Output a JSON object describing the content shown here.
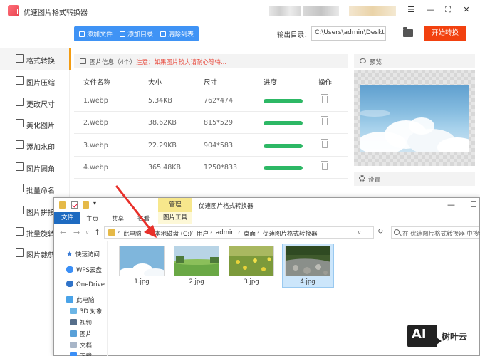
{
  "app": {
    "title": "优速图片格式转换器"
  },
  "sidebar": {
    "items": [
      {
        "label": "格式转换"
      },
      {
        "label": "图片压缩"
      },
      {
        "label": "更改尺寸"
      },
      {
        "label": "美化图片"
      },
      {
        "label": "添加水印"
      },
      {
        "label": "图片圆角"
      },
      {
        "label": "批量命名"
      },
      {
        "label": "图片拼接"
      },
      {
        "label": "批量旋转"
      },
      {
        "label": "图片裁剪"
      }
    ]
  },
  "toolbar": {
    "add_file": "添加文件",
    "add_folder": "添加目录",
    "clear_list": "清除列表",
    "output_label": "输出目录：",
    "output_path": "C:\\Users\\admin\\Deskto",
    "convert_label": "开始转换"
  },
  "file_panel": {
    "title": "图片信息",
    "count": "（4个）",
    "note": "注意：如果图片较大请耐心等待...",
    "columns": [
      "文件名称",
      "大小",
      "尺寸",
      "进度",
      "操作"
    ],
    "rows": [
      {
        "name": "1.webp",
        "size": "5.34KB",
        "dims": "762*474",
        "progress": 1.0
      },
      {
        "name": "2.webp",
        "size": "38.62KB",
        "dims": "815*529",
        "progress": 1.0
      },
      {
        "name": "3.webp",
        "size": "22.29KB",
        "dims": "904*583",
        "progress": 1.0
      },
      {
        "name": "4.webp",
        "size": "365.48KB",
        "dims": "1250*833",
        "progress": 1.0
      }
    ]
  },
  "preview": {
    "title": "预览",
    "settings_title": "设置"
  },
  "explorer": {
    "context_tab": "管理",
    "title": "优速图片格式转换器",
    "ribbon": {
      "file": "文件",
      "home": "主页",
      "share": "共享",
      "view": "查看",
      "tools": "图片工具"
    },
    "breadcrumb": [
      "此电脑",
      "本地磁盘 (C:)",
      "用户",
      "admin",
      "桌面",
      "优速图片格式转换器"
    ],
    "search_placeholder": "在 优速图片格式转换器 中搜索",
    "nav": {
      "quick_access": "快速访问",
      "wps": "WPS云盘",
      "onedrive": "OneDrive",
      "this_pc": "此电脑",
      "objects3d": "3D 对象",
      "videos": "视频",
      "pictures": "图片",
      "documents": "文档",
      "downloads": "下载"
    },
    "files": [
      {
        "name": "1.jpg"
      },
      {
        "name": "2.jpg"
      },
      {
        "name": "3.jpg"
      },
      {
        "name": "4.jpg"
      }
    ]
  },
  "watermark": {
    "mark": "AI",
    "text": "树叶云"
  },
  "colors": {
    "accent_blue": "#3f93f5",
    "convert_red": "#f2410f",
    "progress_green": "#2db865",
    "note_red": "#e8473a",
    "active_marker": "#f39c12"
  }
}
